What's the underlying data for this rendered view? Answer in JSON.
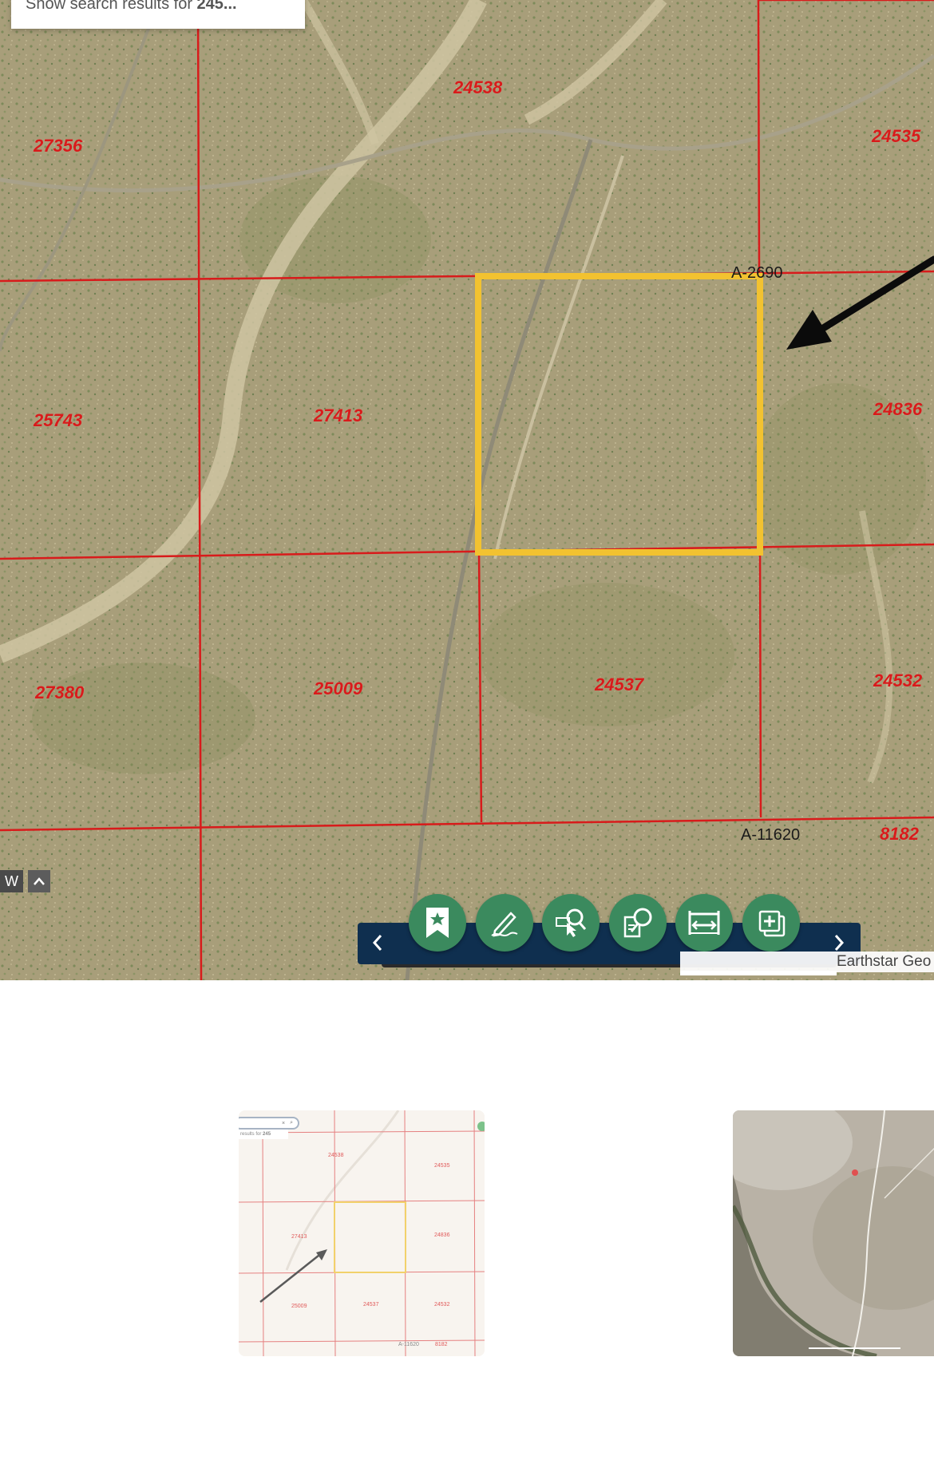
{
  "search": {
    "prefix": "Show search results for ",
    "query": "245..."
  },
  "map": {
    "parcels": [
      "27356",
      "24538",
      "24535",
      "25743",
      "27413",
      "24836",
      "27380",
      "25009",
      "24537",
      "24532",
      "8182"
    ],
    "road_labels": [
      "A-2690",
      "A-11620"
    ],
    "overview_toggle_label": "W",
    "attribution": "Earthstar Geo",
    "colors": {
      "parcel_line": "#d81b1b",
      "highlight": "#f2c230",
      "toolbar": "#0f2f4f",
      "tool_button": "#3b8a5e"
    }
  },
  "toolbar": {
    "tools": [
      "bookmark-icon",
      "draw-icon",
      "select-icon",
      "search-icon",
      "measure-icon",
      "add-layer-icon"
    ]
  },
  "thumbnail1": {
    "search_prefix": "results for ",
    "search_query": "245",
    "parcels": [
      "24538",
      "24535",
      "27413",
      "24836",
      "25009",
      "24537",
      "24532",
      "A-11620",
      "8182"
    ]
  }
}
